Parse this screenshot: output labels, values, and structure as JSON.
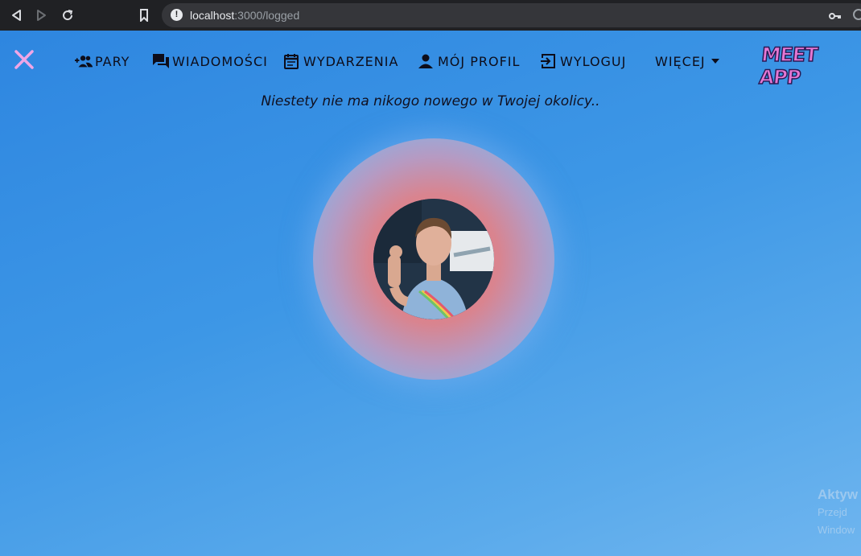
{
  "browser": {
    "url_host": "localhost",
    "url_path": ":3000/logged"
  },
  "nav": {
    "items": [
      {
        "label": "PARY",
        "icon": "add-people-icon"
      },
      {
        "label": "WIADOMOŚCI",
        "icon": "chat-icon"
      },
      {
        "label": "WYDARZENIA",
        "icon": "calendar-icon"
      },
      {
        "label": "MÓJ PROFIL",
        "icon": "person-icon"
      },
      {
        "label": "WYLOGUJ",
        "icon": "logout-icon"
      },
      {
        "label": "WIĘCEJ",
        "icon": "caret-down-icon"
      }
    ],
    "logo": "MEET APP"
  },
  "main": {
    "message": "Niestety nie ma nikogo nowego w Twojej okolicy.."
  },
  "watermark": {
    "line1": "Aktyw",
    "line2": "Przejd",
    "line3": "Window"
  },
  "colors": {
    "close_icon": "#f0a6e6",
    "logo": "#e577d3"
  }
}
